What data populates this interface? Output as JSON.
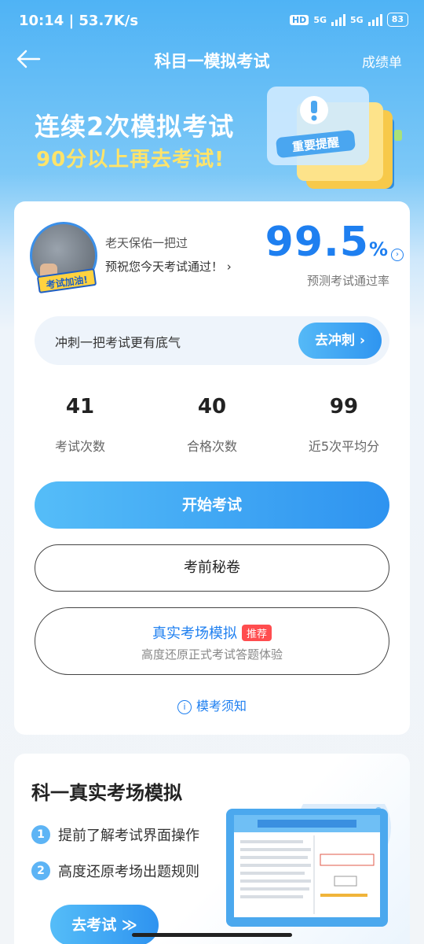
{
  "status_bar": {
    "time_speed": "10:14 | 53.7K/s",
    "hd": "HD",
    "net1": "5G",
    "net2": "5G",
    "battery": "83"
  },
  "nav": {
    "title": "科目一模拟考试",
    "right": "成绩单"
  },
  "banner": {
    "line1": "连续2次模拟考试",
    "line2": "90分以上再去考试!",
    "art_text": "重要提醒"
  },
  "profile": {
    "badge": "考试加油!",
    "greeting": "老天保佑一把过",
    "prediction": "预祝您今天考试通过！",
    "pass_rate": "99.5",
    "pass_rate_unit": "%",
    "pass_rate_label": "预测考试通过率"
  },
  "sprint": {
    "text": "冲刺一把考试更有底气",
    "button": "去冲刺"
  },
  "stats": [
    {
      "value": "41",
      "label": "考试次数"
    },
    {
      "value": "40",
      "label": "合格次数"
    },
    {
      "value": "99",
      "label": "近5次平均分"
    }
  ],
  "buttons": {
    "start": "开始考试",
    "secret": "考前秘卷",
    "real_title": "真实考场模拟",
    "real_tag": "推荐",
    "real_sub": "高度还原正式考试答题体验",
    "notice": "模考须知"
  },
  "section2": {
    "title": "科一真实考场模拟",
    "points": [
      {
        "num": "1",
        "text": "提前了解考试界面操作"
      },
      {
        "num": "2",
        "text": "高度还原考场出题规则"
      }
    ],
    "go_button": "去考试 ≫"
  },
  "colors": {
    "accent": "#2e93f0",
    "highlight": "#ffe46a",
    "tag_red": "#ff4d4f"
  }
}
